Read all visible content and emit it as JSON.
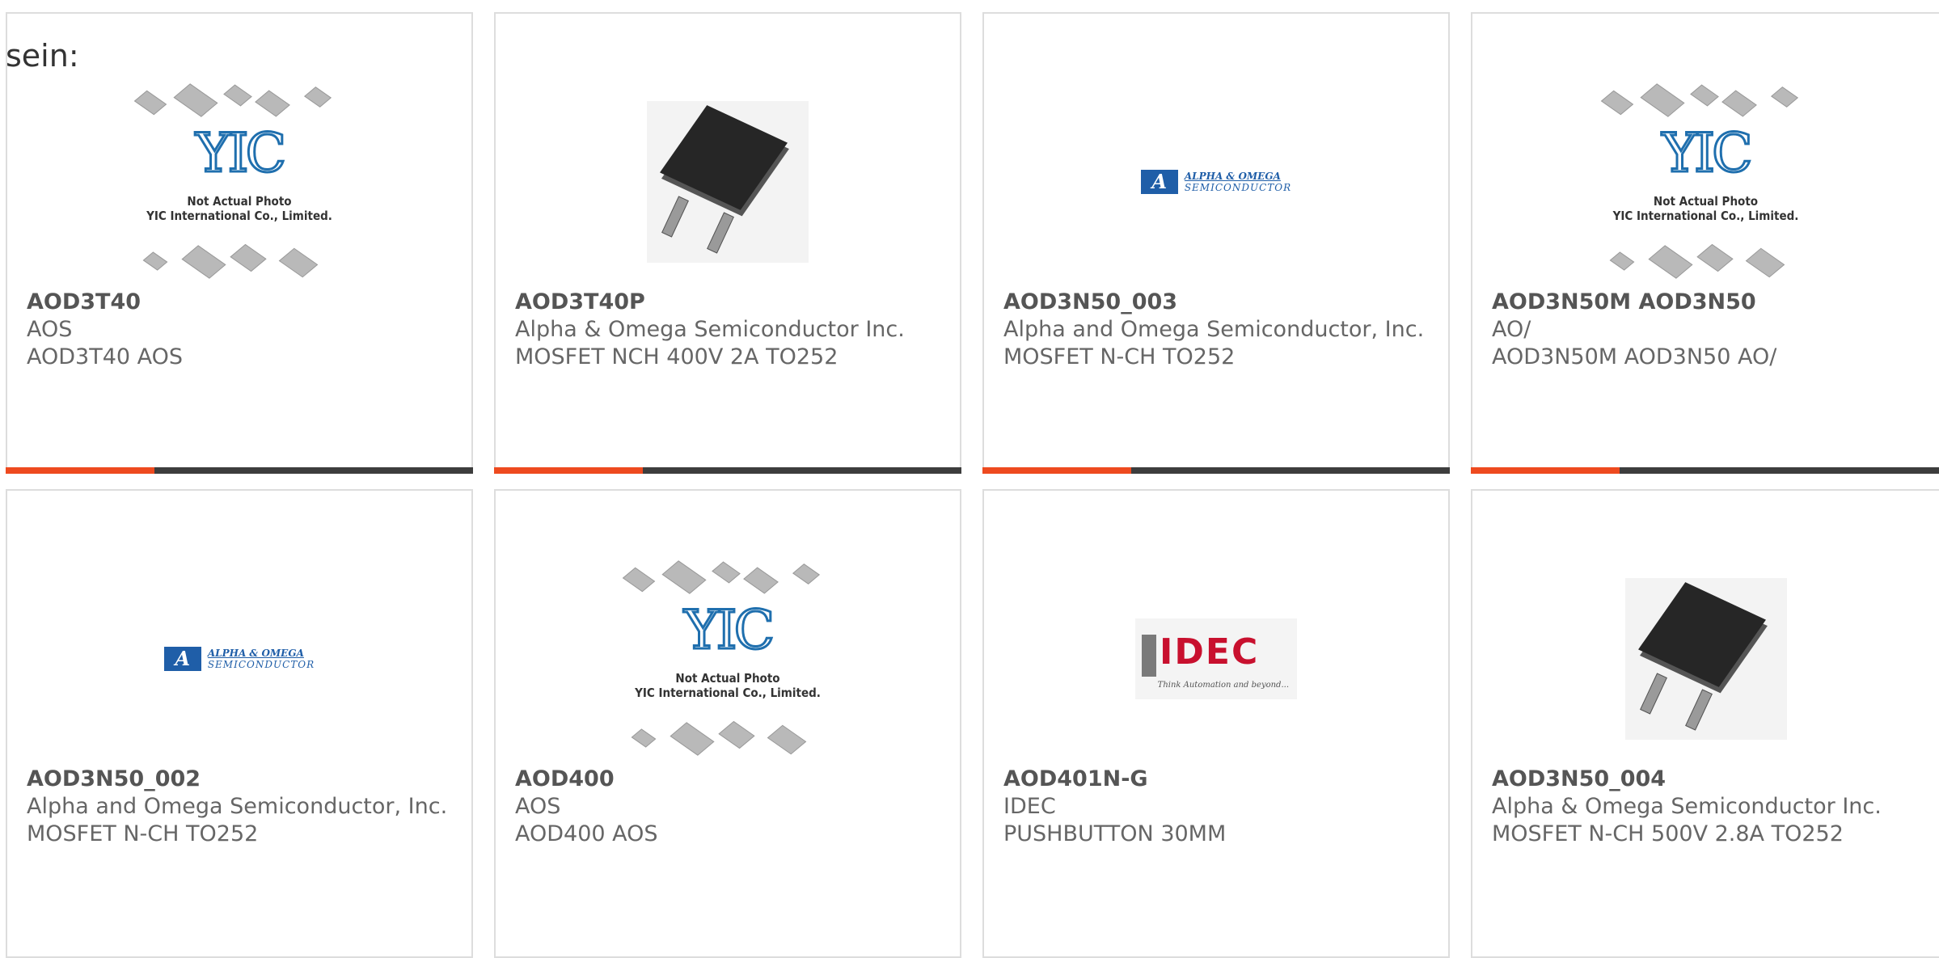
{
  "intro": "sein:",
  "cards": [
    {
      "part": "AOD3T40",
      "mfr": "AOS",
      "desc": "AOD3T40 AOS",
      "image": "yic-placeholder"
    },
    {
      "part": "AOD3T40P",
      "mfr": "Alpha & Omega Semiconductor Inc.",
      "desc": "MOSFET NCH 400V 2A TO252",
      "image": "to252-package"
    },
    {
      "part": "AOD3N50_003",
      "mfr": "Alpha and Omega Semiconductor, Inc.",
      "desc": "MOSFET N-CH TO252",
      "image": "alpha-omega-logo"
    },
    {
      "part": "AOD3N50M AOD3N50",
      "mfr": "AO/",
      "desc": "AOD3N50M AOD3N50 AO/",
      "image": "yic-placeholder"
    },
    {
      "part": "AOD3N50_002",
      "mfr": "Alpha and Omega Semiconductor, Inc.",
      "desc": "MOSFET N-CH TO252",
      "image": "alpha-omega-logo"
    },
    {
      "part": "AOD400",
      "mfr": "AOS",
      "desc": "AOD400 AOS",
      "image": "yic-placeholder"
    },
    {
      "part": "AOD401N-G",
      "mfr": "IDEC",
      "desc": "PUSHBUTTON 30MM",
      "image": "idec-logo"
    },
    {
      "part": "AOD3N50_004",
      "mfr": "Alpha & Omega Semiconductor Inc.",
      "desc": "MOSFET N-CH 500V 2.8A TO252",
      "image": "to252-package"
    }
  ],
  "yic_note": {
    "line1": "Not Actual Photo",
    "line2": "YIC International Co., Limited.",
    "logo": "YIC"
  },
  "ao_logo": {
    "mark": "A",
    "line1": "ALPHA & OMEGA",
    "line2": "SEMICONDUCTOR"
  },
  "idec_logo": {
    "word": "IDEC",
    "tagline": "Think Automation and beyond..."
  },
  "colors": {
    "accent": "#ee4a1f",
    "bar": "#3d3d3d",
    "border": "#dddddd"
  }
}
